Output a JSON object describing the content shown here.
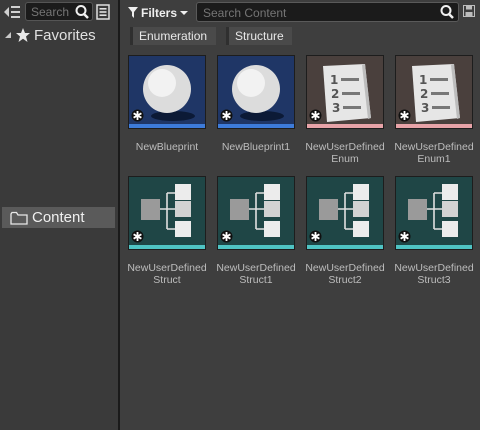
{
  "sidebar": {
    "search_placeholder": "Search",
    "favorites_label": "Favorites",
    "content_label": "Content"
  },
  "toolbar": {
    "filters_label": "Filters",
    "search_placeholder": "Search Content"
  },
  "filter_chips": [
    "Enumeration",
    "Structure"
  ],
  "assets": [
    {
      "line1": "NewBlueprint",
      "line2": ""
    },
    {
      "line1": "NewBlueprint1",
      "line2": ""
    },
    {
      "line1": "NewUserDefined",
      "line2": "Enum"
    },
    {
      "line1": "NewUserDefined",
      "line2": "Enum1"
    },
    {
      "line1": "NewUserDefined",
      "line2": "Struct"
    },
    {
      "line1": "NewUserDefined",
      "line2": "Struct1"
    },
    {
      "line1": "NewUserDefined",
      "line2": "Struct2"
    },
    {
      "line1": "NewUserDefined",
      "line2": "Struct3"
    }
  ],
  "colors": {
    "blueprint_bg": "#1f3666",
    "blueprint_strip": "#3d7bd9",
    "enum_bg": "#4a403d",
    "enum_strip": "#e8a3a8",
    "struct_bg": "#1f4646",
    "struct_strip": "#4fc4c4",
    "selection": "#5a5a5a"
  },
  "icons": {
    "sidebar_toggle": "sidebar-toggle-icon",
    "search": "search-icon",
    "view_options": "view-options-icon",
    "favorites": "star-icon",
    "folder": "folder-icon",
    "filter": "funnel-icon",
    "save": "save-icon"
  }
}
